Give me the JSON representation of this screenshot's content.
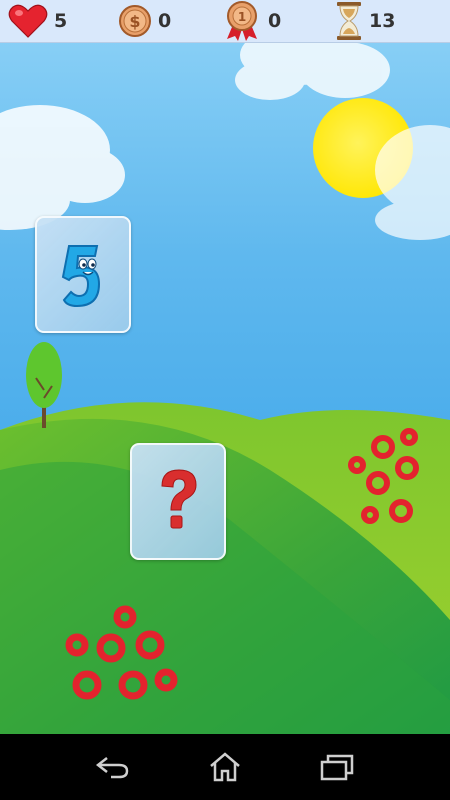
{
  "hud": {
    "lives": "5",
    "coins": "0",
    "medals": "0",
    "time": "13"
  },
  "cards": [
    {
      "state": "revealed",
      "face": "5"
    },
    {
      "state": "hidden",
      "face": "?"
    }
  ],
  "colors": {
    "sky_top": "#1a8fe3",
    "sky_bottom": "#7fc8f2",
    "hill_dark": "#2fa03a",
    "hill_light": "#a8d532",
    "sun": "#ffea00",
    "flower": "#e3232e",
    "question": "#d92e2e",
    "digit": "#22a8e6"
  },
  "icons": {
    "lives": "heart-icon",
    "coins": "coin-icon",
    "medals": "medal-icon",
    "time": "hourglass-icon"
  }
}
